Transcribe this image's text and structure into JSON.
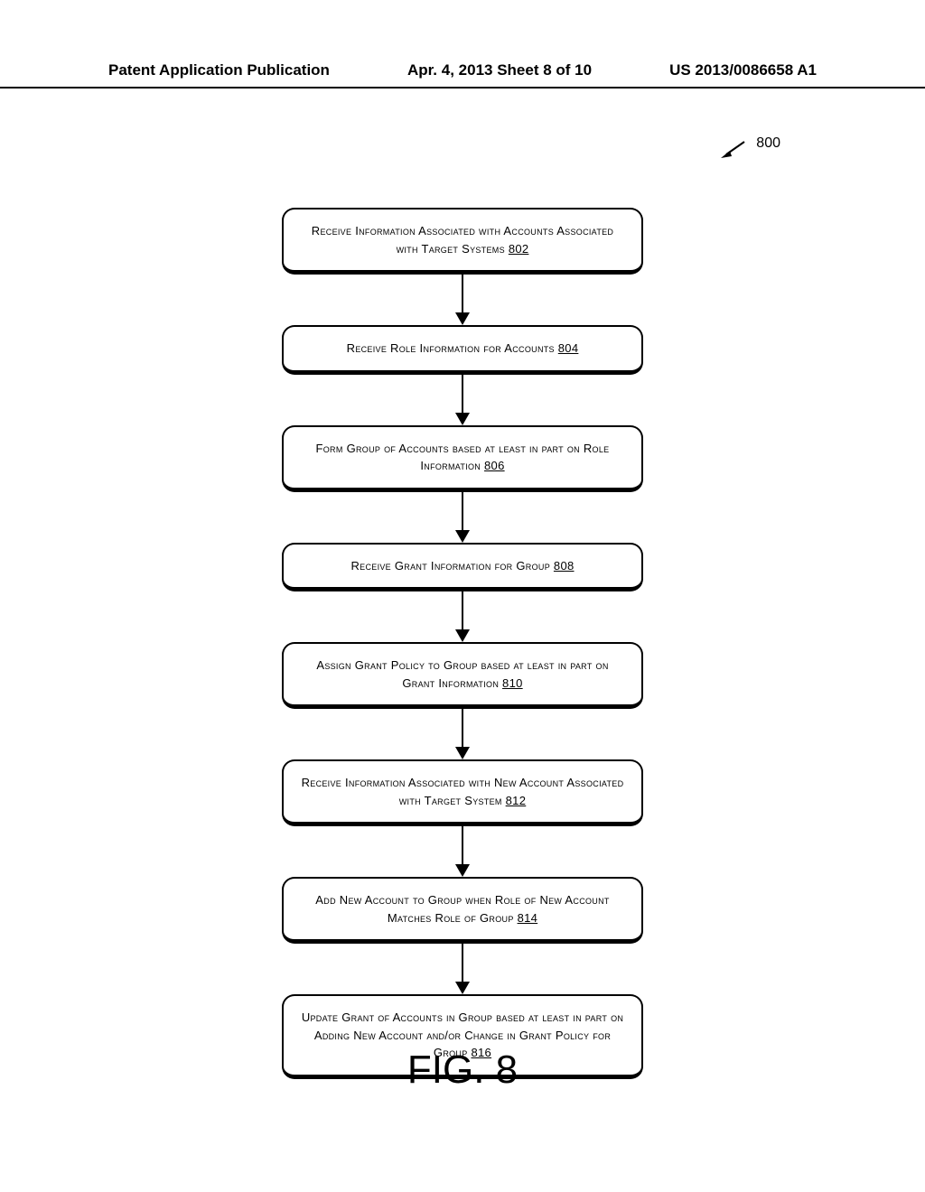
{
  "header": {
    "left": "Patent Application Publication",
    "center": "Apr. 4, 2013  Sheet 8 of 10",
    "right": "US 2013/0086658 A1"
  },
  "ref_number": "800",
  "steps": [
    {
      "text": "Receive Information Associated with Accounts Associated with Target Systems",
      "ref": "802"
    },
    {
      "text": "Receive Role Information for Accounts",
      "ref": "804"
    },
    {
      "text": "Form Group of Accounts based at least in part on Role Information",
      "ref": "806"
    },
    {
      "text": "Receive Grant Information for Group",
      "ref": "808"
    },
    {
      "text": "Assign Grant Policy to Group based at least in part on Grant Information",
      "ref": "810"
    },
    {
      "text": "Receive Information Associated with New Account Associated with Target System",
      "ref": "812"
    },
    {
      "text": "Add New Account to Group when Role of New Account Matches Role of Group",
      "ref": "814"
    },
    {
      "text": "Update Grant of Accounts in Group based at least in part on Adding New Account and/or Change in Grant Policy for Group",
      "ref": "816"
    }
  ],
  "figure_caption": "FIG. 8"
}
